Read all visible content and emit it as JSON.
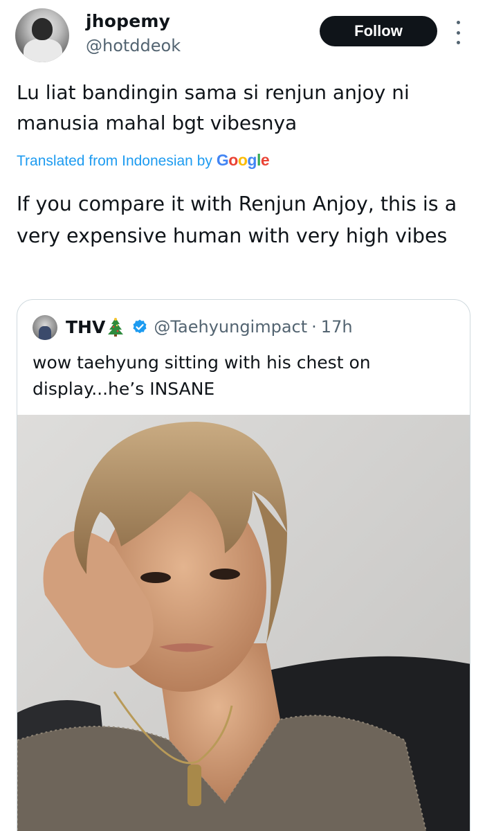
{
  "author": {
    "display_name": "jhopemy",
    "handle": "@hotddeok",
    "avatar_icon": "profile-avatar"
  },
  "actions": {
    "follow_label": "Follow",
    "more_icon": "more-vertical-icon"
  },
  "tweet": {
    "original_text": "Lu liat bandingin sama si renjun anjoy ni manusia mahal bgt vibesnya",
    "translated_label": "Translated from Indonesian by",
    "translator_brand": {
      "letters": [
        "G",
        "o",
        "o",
        "g",
        "l",
        "e"
      ],
      "colors": [
        "#4285f4",
        "#ea4335",
        "#fbbc05",
        "#4285f4",
        "#34a853",
        "#ea4335"
      ]
    },
    "translated_text": "If you compare it with Renjun Anjoy, this is a very expensive human with very high vibes"
  },
  "quote": {
    "display_name": "THV",
    "name_emoji_icon": "christmas-tree-icon",
    "verified_icon": "verified-badge-icon",
    "handle": "@Taehyungimpact",
    "separator": "·",
    "time": "17h",
    "text": "wow taehyung sitting with his chest on display...he’s INSANE",
    "media_icon": "portrait-photo"
  },
  "colors": {
    "link_blue": "#1d9bf0",
    "secondary_text": "#536471",
    "primary_text": "#0f1419",
    "follow_bg": "#0f1419",
    "card_border": "#cfd9de"
  }
}
